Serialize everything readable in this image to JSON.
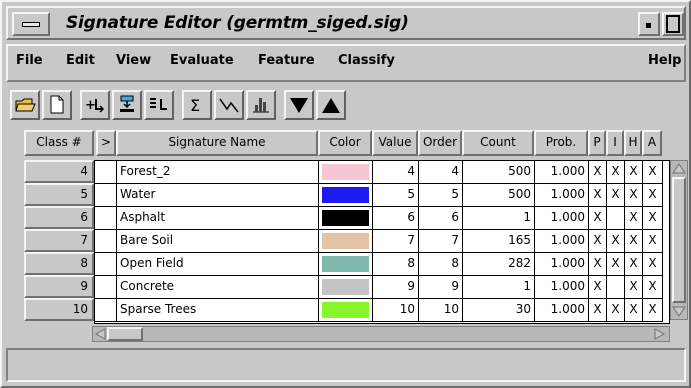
{
  "window": {
    "title": "Signature Editor (germtm_siged.sig)"
  },
  "menu": {
    "file": "File",
    "edit": "Edit",
    "view": "View",
    "evaluate": "Evaluate",
    "feature": "Feature",
    "classify": "Classify",
    "help": "Help"
  },
  "toolbar": {
    "icons": [
      "open-folder-icon",
      "new-document-icon",
      "add-signature-icon",
      "replace-signature-icon",
      "merge-signature-icon",
      "statistics-sigma-icon",
      "mean-plot-icon",
      "histogram-icon",
      "move-down-icon",
      "move-up-icon"
    ]
  },
  "table": {
    "headers": {
      "class": "Class #",
      "marker": ">",
      "name": "Signature Name",
      "color": "Color",
      "value": "Value",
      "order": "Order",
      "count": "Count",
      "prob": "Prob.",
      "p": "P",
      "i": "I",
      "h": "H",
      "a": "A"
    },
    "rows": [
      {
        "class": "4",
        "name": "Forest_2",
        "color": "#f7c6d4",
        "value": "4",
        "order": "4",
        "count": "500",
        "prob": "1.000",
        "p": "X",
        "i": "X",
        "h": "X",
        "a": "X"
      },
      {
        "class": "5",
        "name": "Water",
        "color": "#1c1cf2",
        "value": "5",
        "order": "5",
        "count": "500",
        "prob": "1.000",
        "p": "X",
        "i": "X",
        "h": "X",
        "a": "X"
      },
      {
        "class": "6",
        "name": "Asphalt",
        "color": "#000000",
        "value": "6",
        "order": "6",
        "count": "1",
        "prob": "1.000",
        "p": "X",
        "i": "",
        "h": "X",
        "a": "X"
      },
      {
        "class": "7",
        "name": "Bare Soil",
        "color": "#e3c2a6",
        "value": "7",
        "order": "7",
        "count": "165",
        "prob": "1.000",
        "p": "X",
        "i": "X",
        "h": "X",
        "a": "X"
      },
      {
        "class": "8",
        "name": "Open Field",
        "color": "#7fb9ae",
        "value": "8",
        "order": "8",
        "count": "282",
        "prob": "1.000",
        "p": "X",
        "i": "X",
        "h": "X",
        "a": "X"
      },
      {
        "class": "9",
        "name": "Concrete",
        "color": "#c4c4c4",
        "value": "9",
        "order": "9",
        "count": "1",
        "prob": "1.000",
        "p": "X",
        "i": "",
        "h": "X",
        "a": "X"
      },
      {
        "class": "10",
        "name": "Sparse Trees",
        "color": "#86f52a",
        "value": "10",
        "order": "10",
        "count": "30",
        "prob": "1.000",
        "p": "X",
        "i": "X",
        "h": "X",
        "a": "X"
      }
    ]
  },
  "status": {
    "text": ""
  }
}
